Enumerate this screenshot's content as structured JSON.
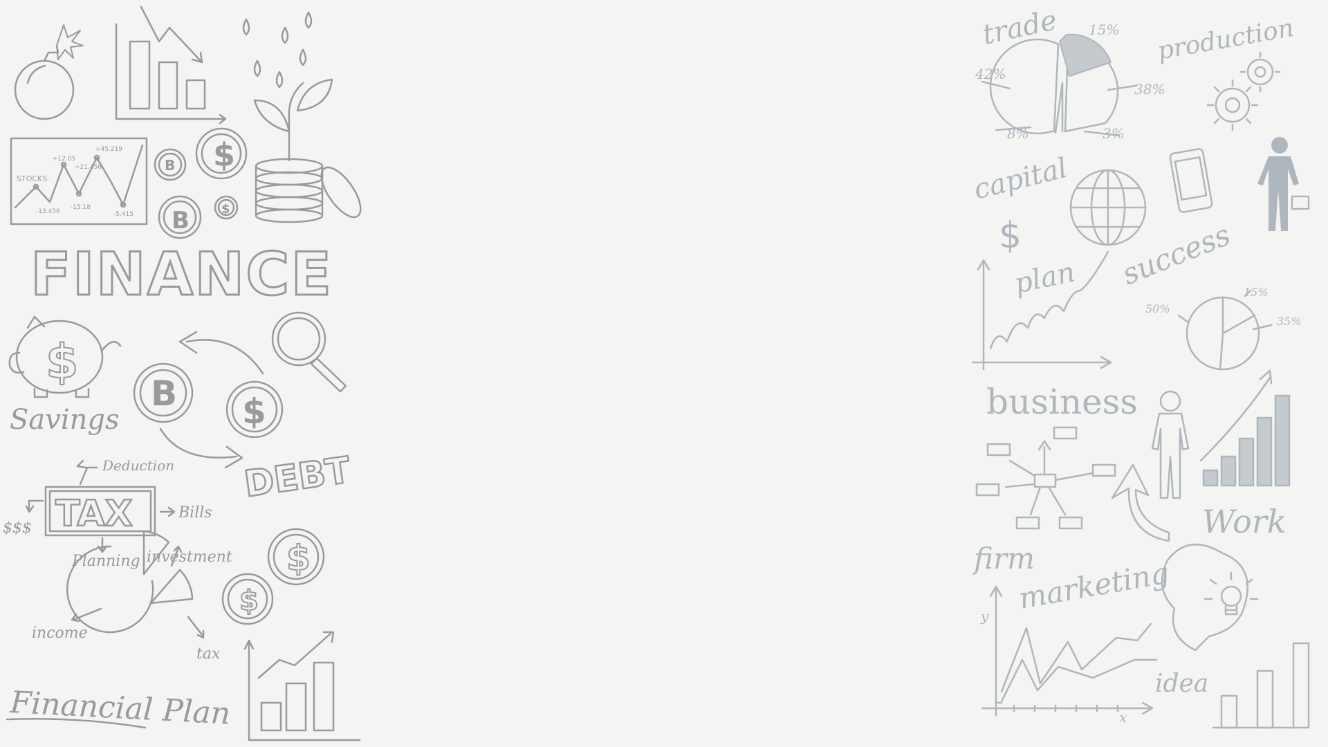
{
  "left_panel": {
    "heading": "FINANCE",
    "stocks_label": "STOCKS",
    "stock_values": [
      "+12.05",
      "+21.456",
      "+45.219",
      "-13.456",
      "-15.18",
      "-5.415"
    ],
    "savings_label": "Savings",
    "debt_label": "DEBT",
    "deduction_label": "Deduction",
    "tax_label": "TAX",
    "bills_label": "Bills",
    "dollars_label": "$$$",
    "planning_label": "Planning",
    "investment_label": "investment",
    "income_label": "income",
    "tax_small_label": "tax",
    "financial_plan_label": "Financial Plan"
  },
  "right_panel": {
    "trade_label": "trade",
    "production_label": "production",
    "pie_percentages": [
      "15%",
      "42%",
      "38%",
      "8%",
      "3%"
    ],
    "capital_label": "capital",
    "plan_label": "plan",
    "success_label": "success",
    "small_pie_percentages": [
      "50%",
      "15%",
      "35%"
    ],
    "business_label": "business",
    "work_label": "Work",
    "firm_label": "firm",
    "marketing_label": "marketing",
    "idea_label": "idea",
    "axis_y": "y",
    "axis_x": "x"
  },
  "colors": {
    "background": "#f4f4f2",
    "left_ink": "#9a9a9a",
    "right_ink": "#aeb7bd"
  }
}
